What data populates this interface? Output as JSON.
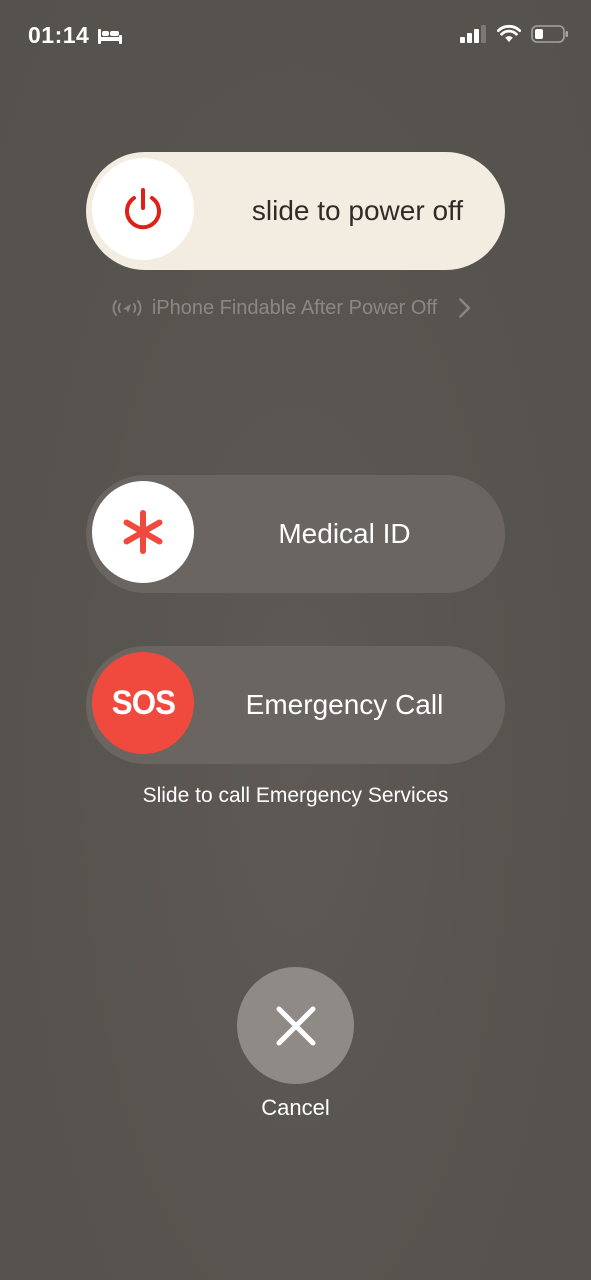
{
  "status_bar": {
    "time": "01:14",
    "sleep_icon": "bed-icon",
    "signal_icon": "cellular-signal-icon",
    "wifi_icon": "wifi-icon",
    "battery_icon": "battery-icon"
  },
  "power_slider": {
    "label": "slide to power off",
    "icon": "power-icon",
    "knob_color": "#ffffff",
    "icon_color": "#e02018",
    "track_color": "#f3ece0"
  },
  "findable": {
    "text": "iPhone Findable After Power Off",
    "icon": "find-my-icon",
    "chevron": "chevron-right-icon"
  },
  "medical_slider": {
    "label": "Medical ID",
    "icon": "asterisk-icon",
    "icon_color": "#f04a3f"
  },
  "sos_slider": {
    "knob_text": "SOS",
    "label": "Emergency Call",
    "knob_color": "#f04a3f"
  },
  "sos_caption": "Slide to call Emergency Services",
  "cancel": {
    "label": "Cancel",
    "icon": "close-icon"
  }
}
